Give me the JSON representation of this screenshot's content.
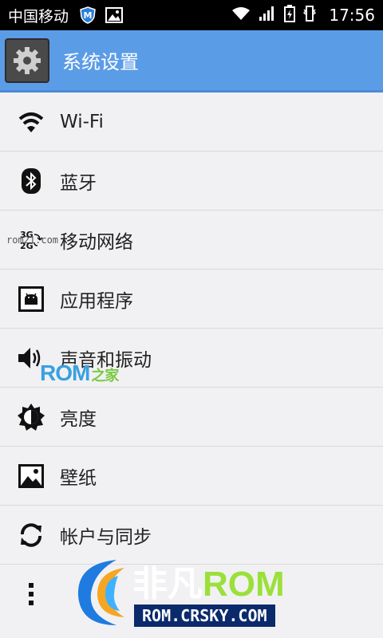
{
  "status_bar": {
    "carrier": "中国移动",
    "time": "17:56",
    "icons": [
      "shield-app-icon",
      "image-notification-icon",
      "wifi-icon",
      "signal-icon",
      "battery-charging-icon",
      "vibrate-icon"
    ]
  },
  "action_bar": {
    "title": "系统设置",
    "icon": "gear-icon"
  },
  "settings": {
    "items": [
      {
        "label": "Wi-Fi",
        "icon": "wifi-icon"
      },
      {
        "label": "蓝牙",
        "icon": "bluetooth-icon"
      },
      {
        "label": "移动网络",
        "icon": "mobile-network-icon"
      },
      {
        "label": "应用程序",
        "icon": "android-apps-icon"
      },
      {
        "label": "声音和振动",
        "icon": "speaker-icon"
      },
      {
        "label": "亮度",
        "icon": "brightness-icon"
      },
      {
        "label": "壁纸",
        "icon": "wallpaper-icon"
      },
      {
        "label": "帐户与同步",
        "icon": "sync-icon"
      },
      {
        "label": "",
        "icon": "more-icon"
      }
    ]
  },
  "watermarks": {
    "small": "rom21.com",
    "rom_logo": "ROM",
    "rom_logo_suffix": "之家",
    "brand_left": "非凡",
    "brand_right": "ROM",
    "url": "ROM.CRSKY.COM"
  },
  "colors": {
    "action_bar": "#5b9ce7",
    "background": "#f1f1f3",
    "status_bar": "#000000"
  }
}
